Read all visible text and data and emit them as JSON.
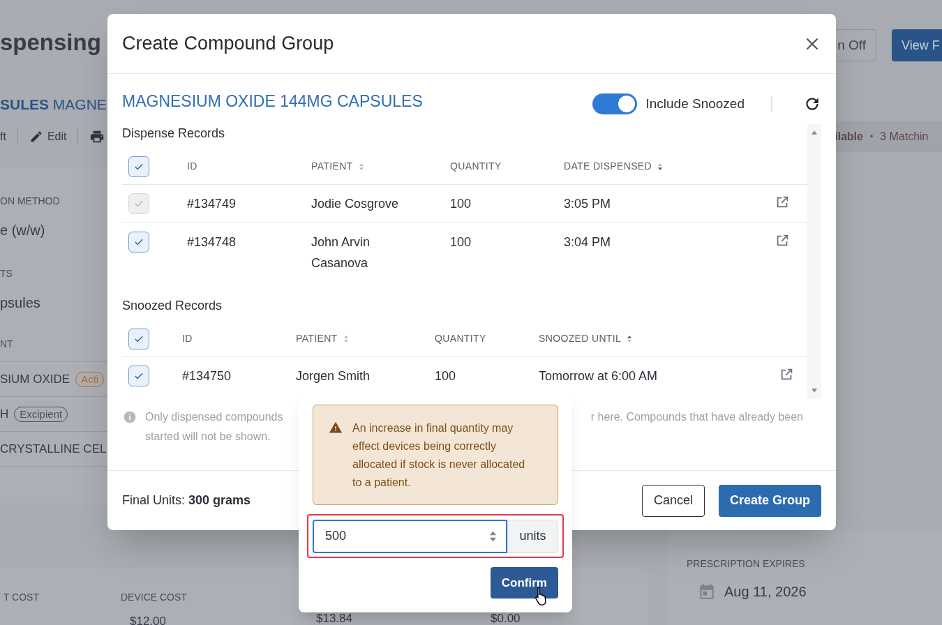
{
  "background": {
    "title": "spensing",
    "subtitle_bold": "SULES",
    "subtitle": "MAGNE",
    "toolbar": [
      {
        "kind": "text",
        "label": "ft"
      },
      {
        "kind": "edit",
        "label": "Edit"
      },
      {
        "kind": "print"
      }
    ],
    "header_buttons": [
      {
        "kind": "outline",
        "label": "n Off"
      },
      {
        "kind": "primary",
        "label": "View F"
      }
    ],
    "status": {
      "bold": "ilable",
      "separator": "•",
      "text": "3 Matchin"
    },
    "fields": [
      {
        "label": "ON METHOD",
        "value": "e (w/w)"
      },
      {
        "label": "TS",
        "value": "psules"
      }
    ],
    "ingredients_label": "NT",
    "ingredients": [
      {
        "name": "SIUM OXIDE",
        "badge": "Acti",
        "color": "#b86f22"
      },
      {
        "name": "H",
        "badge": "Excipient",
        "color": "#4a5463"
      },
      {
        "name": "CRYSTALLINE CEL"
      }
    ],
    "costs": [
      {
        "label": "T COST"
      },
      {
        "label": "DEVICE COST",
        "value": "$12.00"
      },
      {
        "value": "$13.84"
      },
      {
        "value": "$0.00"
      }
    ],
    "expires": {
      "label": "PRESCRIPTION EXPIRES",
      "value": "Aug 11, 2026"
    }
  },
  "modal": {
    "title": "Create Compound Group",
    "product": "MAGNESIUM OXIDE 144MG CAPSULES",
    "include_snoozed": {
      "label": "Include Snoozed",
      "on": true
    },
    "sections": [
      {
        "kind": "dispense",
        "title": "Dispense Records",
        "all_checked": true,
        "columns": [
          {
            "label": "ID"
          },
          {
            "label": "PATIENT",
            "sorted_asc": false,
            "sorted_desc": false
          },
          {
            "label": "QUANTITY"
          },
          {
            "label": "DATE DISPENSED",
            "sorted_asc": false,
            "sorted_desc": true
          }
        ],
        "rows": [
          {
            "id": "#134749",
            "patient": "Jodie Cosgrove",
            "quantity": "100",
            "date": "3:05 PM",
            "checked": true,
            "disabled": true
          },
          {
            "id": "#134748",
            "patient": "John Arvin Casanova",
            "quantity": "100",
            "date": "3:04 PM",
            "checked": true,
            "disabled": false
          }
        ]
      },
      {
        "kind": "snoozed",
        "title": "Snoozed Records",
        "all_checked": true,
        "columns": [
          {
            "label": "ID"
          },
          {
            "label": "PATIENT",
            "sorted_asc": false,
            "sorted_desc": false
          },
          {
            "label": "QUANTITY"
          },
          {
            "label": "SNOOZED UNTIL",
            "sorted_asc": true,
            "sorted_desc": false
          }
        ],
        "rows": [
          {
            "id": "#134750",
            "patient": "Jorgen Smith",
            "quantity": "100",
            "date": "Tomorrow at 6:00 AM",
            "checked": true,
            "disabled": false
          }
        ]
      }
    ],
    "info_left": "Only dispensed compounds",
    "info_right": "r here. Compounds that have already been",
    "info_line2": "started will not be shown.",
    "final_units": "Final Units: **300 grams**",
    "buttons": [
      {
        "kind": "secondary",
        "label": "Cancel"
      },
      {
        "kind": "primary",
        "label": "Create Group"
      }
    ]
  },
  "popover": {
    "warning": "An increase in final quantity may effect devices being correctly allocated if stock is never allocated to a patient.",
    "value": "500",
    "unit": "units",
    "error": true,
    "confirm": "Confirm"
  }
}
